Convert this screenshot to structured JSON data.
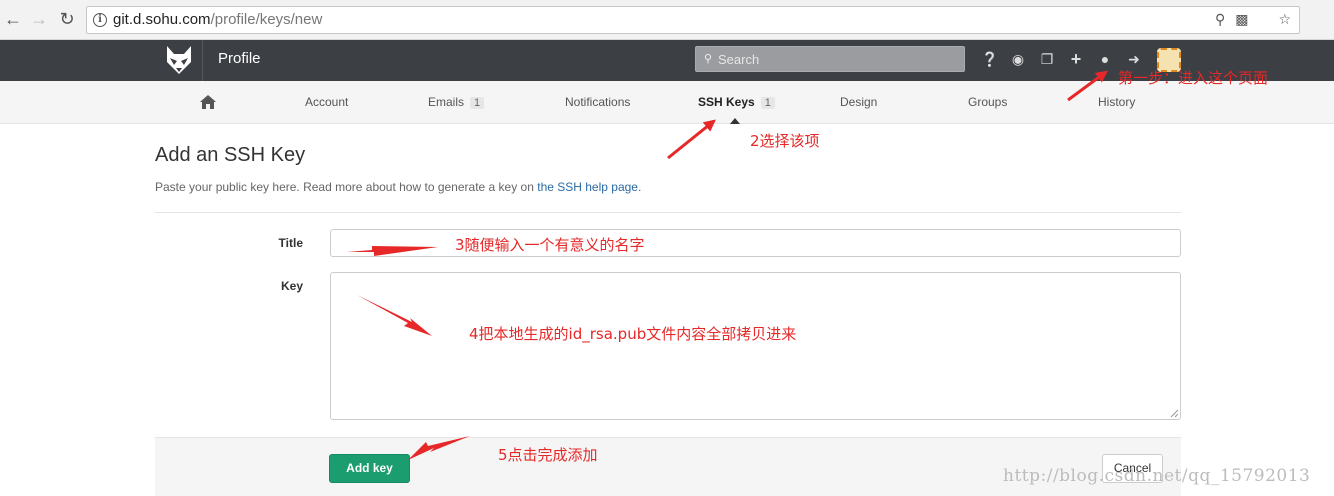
{
  "browser": {
    "url_host": "git.d.sohu.com",
    "url_path": "/profile/keys/new"
  },
  "header": {
    "title": "Profile",
    "search_placeholder": "Search"
  },
  "tabs": [
    {
      "label": "Account",
      "badge": ""
    },
    {
      "label": "Emails",
      "badge": "1"
    },
    {
      "label": "Notifications",
      "badge": ""
    },
    {
      "label": "SSH Keys",
      "badge": "1",
      "active": true
    },
    {
      "label": "Design",
      "badge": ""
    },
    {
      "label": "Groups",
      "badge": ""
    },
    {
      "label": "History",
      "badge": ""
    }
  ],
  "form": {
    "page_title": "Add an SSH Key",
    "lead_text": "Paste your public key here. Read more about how to generate a key on ",
    "lead_link": "the SSH help page",
    "lead_suffix": ".",
    "title_label": "Title",
    "key_label": "Key",
    "add_button": "Add key",
    "cancel_button": "Cancel"
  },
  "annotations": {
    "step1": "第一步：进入这个页面",
    "step2": "2选择该项",
    "step3": "3随便输入一个有意义的名字",
    "step4": "4把本地生成的id_rsa.pub文件内容全部拷贝进来",
    "step5": "5点击完成添加"
  },
  "watermark": "http://blog.csdn.net/qq_15792013",
  "colors": {
    "header_bg": "#3c3f44",
    "add_button": "#1b9d6f",
    "annotation": "#e62828",
    "link": "#2a6ba5"
  }
}
